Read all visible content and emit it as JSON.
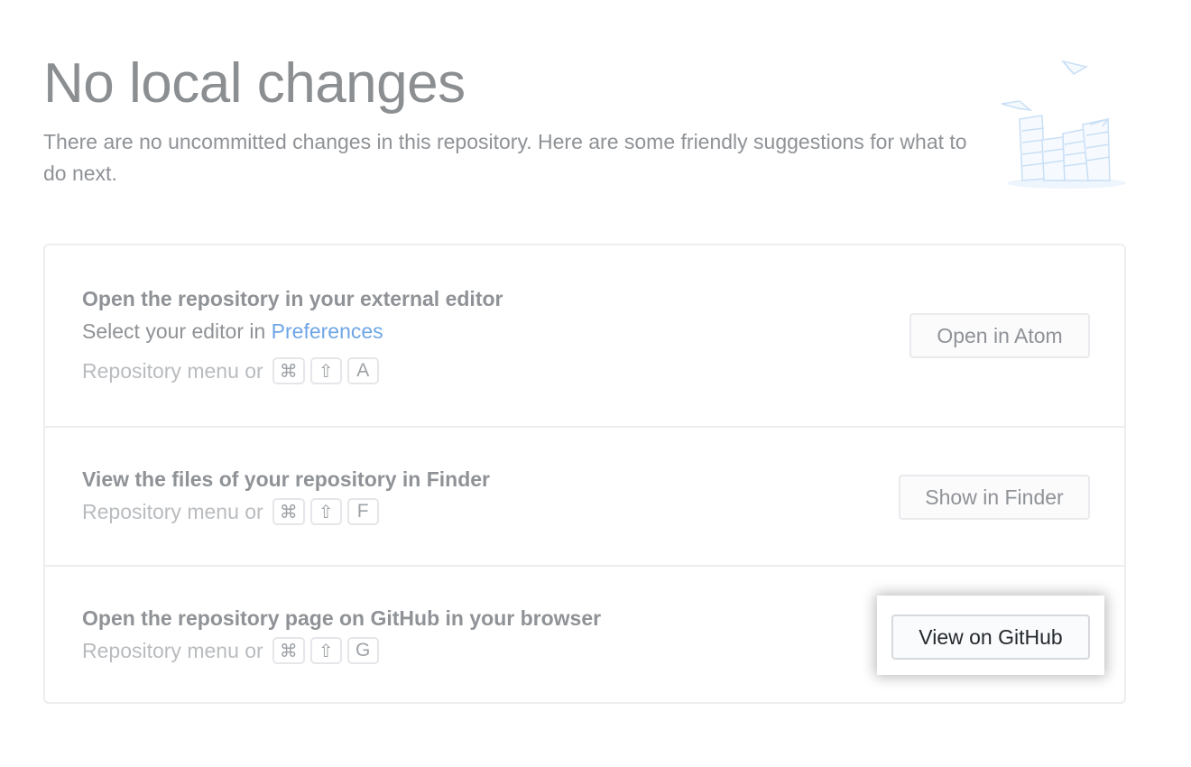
{
  "header": {
    "title": "No local changes",
    "subtitle": "There are no uncommitted changes in this repository. Here are some friendly suggestions for what to do next."
  },
  "suggestions": [
    {
      "title": "Open the repository in your external editor",
      "description_prefix": "Select your editor in ",
      "description_link": "Preferences",
      "shortcut_prefix": "Repository menu or",
      "keys": [
        "⌘",
        "⇧",
        "A"
      ],
      "button_label": "Open in Atom"
    },
    {
      "title": "View the files of your repository in Finder",
      "shortcut_prefix": "Repository menu or",
      "keys": [
        "⌘",
        "⇧",
        "F"
      ],
      "button_label": "Show in Finder"
    },
    {
      "title": "Open the repository page on GitHub in your browser",
      "shortcut_prefix": "Repository menu or",
      "keys": [
        "⌘",
        "⇧",
        "G"
      ],
      "button_label": "View on GitHub"
    }
  ],
  "icons": {
    "illustration": "paper-stacks-illustration",
    "command_key": "command-key-icon",
    "shift_key": "shift-key-icon"
  },
  "colors": {
    "link": "#6fa6e6",
    "muted_text": "#8f9296",
    "border": "#eceef0",
    "active_button_text": "#24292e"
  }
}
